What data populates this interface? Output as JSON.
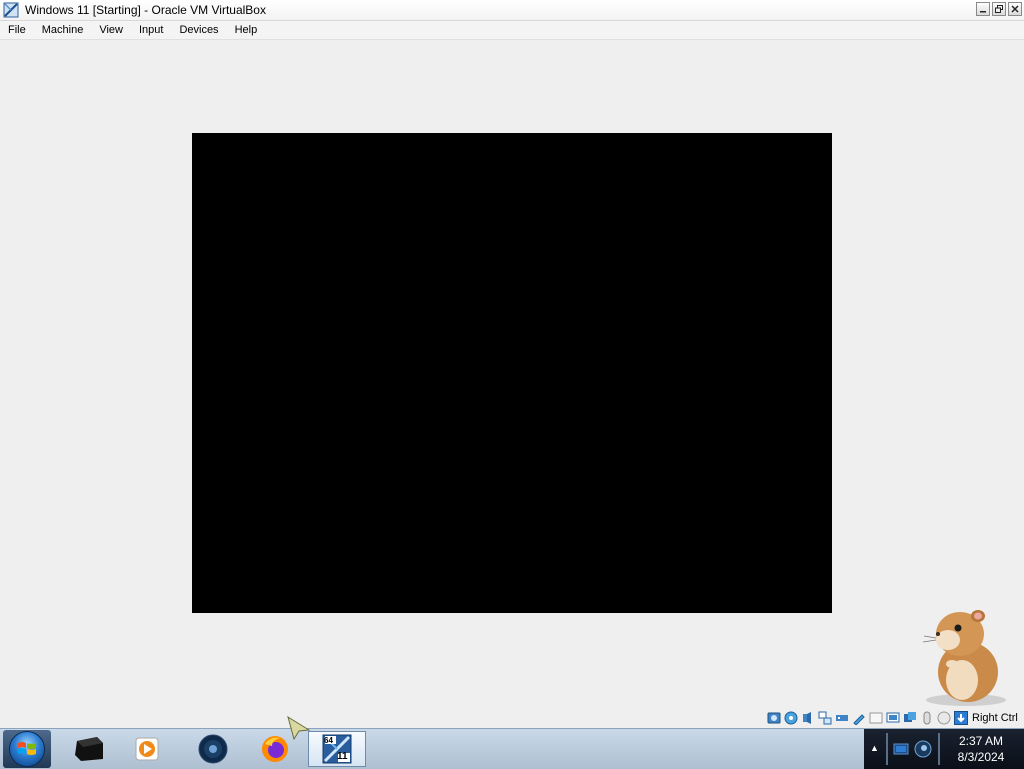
{
  "window": {
    "title": "Windows 11 [Starting] - Oracle VM VirtualBox",
    "controls": [
      "minimize",
      "restore",
      "close"
    ]
  },
  "menubar": {
    "items": [
      "File",
      "Machine",
      "View",
      "Input",
      "Devices",
      "Help"
    ]
  },
  "vm_screen": {
    "state": "black"
  },
  "statusbar": {
    "icons": [
      "hard-disk-icon",
      "optical-drive-icon",
      "audio-icon",
      "network-icon",
      "usb-icon",
      "shared-folders-icon",
      "display-icon",
      "video-capture-icon",
      "virtualization-icon",
      "mouse-integration-icon",
      "keyboard-icon",
      "host-key-arrow-icon"
    ],
    "host_key": "Right Ctrl"
  },
  "taskbar": {
    "apps": [
      {
        "name": "terminal-app",
        "icon": "terminal-icon"
      },
      {
        "name": "media-player-app",
        "icon": "play-icon"
      },
      {
        "name": "steam-app",
        "icon": "steam-icon"
      },
      {
        "name": "firefox-app",
        "icon": "firefox-icon"
      },
      {
        "name": "virtualbox-app",
        "icon": "virtualbox-icon",
        "active": true,
        "badge_top": "64",
        "badge_bottom": "11"
      }
    ],
    "clock": {
      "time": "2:37 AM",
      "date": "8/3/2024"
    }
  }
}
